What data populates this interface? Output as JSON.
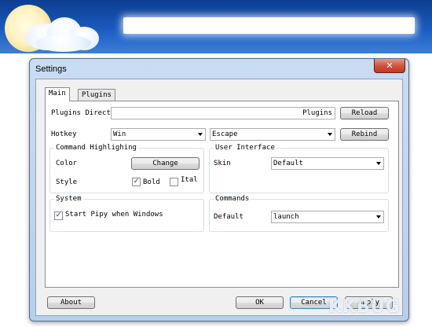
{
  "window": {
    "title": "Settings",
    "close_label": "✕"
  },
  "tabs": [
    {
      "label": "Main"
    },
    {
      "label": "Plugins"
    }
  ],
  "main": {
    "plugins_dir": {
      "label": "Plugins Directo",
      "value": "",
      "suffix": "Plugins",
      "button": "Reload"
    },
    "hotkey": {
      "label": "Hotkey",
      "modifier": "Win",
      "key": "Escape",
      "button": "Rebind"
    },
    "command_highlighting": {
      "title": "Command Highlighing",
      "color_label": "Color",
      "change_button": "Change",
      "style_label": "Style",
      "bold_label": "Bold",
      "bold_checked": true,
      "italic_label": "Ital",
      "italic_checked": false
    },
    "user_interface": {
      "title": "User Interface",
      "skin_label": "Skin",
      "skin_value": "Default"
    },
    "system": {
      "title": "System",
      "start_label": "Start Pipy when Windows",
      "start_checked": true
    },
    "commands": {
      "title": "Commands",
      "default_label": "Default",
      "default_value": "launch"
    }
  },
  "footer": {
    "about": "About",
    "ok": "OK",
    "cancel": "Cancel",
    "apply": "Apply"
  },
  "icons": {
    "checkmark": "✓"
  },
  "watermark": "KKBUG"
}
